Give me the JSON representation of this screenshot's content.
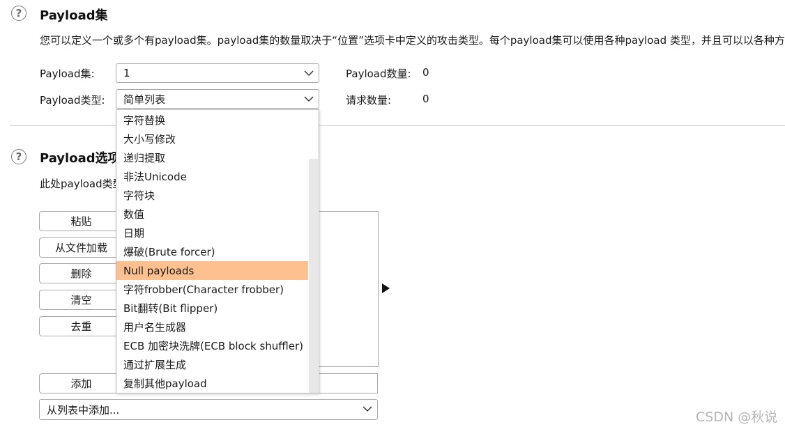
{
  "payload_sets_section": {
    "help_icon": "?",
    "title": "Payload集",
    "description": "您可以定义一个或多个有payload集。payload集的数量取决于“位置”选项卡中定义的攻击类型。每个payload集可以使用各种payload 类型，并且可以以各种方式",
    "payload_set_label": "Payload集:",
    "payload_set_value": "1",
    "payload_count_label": "Payload数量:",
    "payload_count_value": "0",
    "payload_type_label": "Payload类型:",
    "payload_type_value": "简单列表",
    "request_count_label": "请求数量:",
    "request_count_value": "0"
  },
  "payload_options_section": {
    "help_icon": "?",
    "title": "Payload选项",
    "description": "此处payload类型",
    "buttons": {
      "paste": "粘贴",
      "load_from_file": "从文件加载",
      "delete": "删除",
      "clear": "清空",
      "dedupe": "去重",
      "add": "添加"
    },
    "add_from_list": "从列表中添加..."
  },
  "payload_type_dropdown": {
    "items": [
      "字符替换",
      "大小写修改",
      "递归提取",
      "非法Unicode",
      "字符块",
      "数值",
      "日期",
      "爆破(Brute forcer)",
      "Null payloads",
      "字符frobber(Character frobber)",
      "Bit翻转(Bit flipper)",
      "用户名生成器",
      "ECB 加密块洗牌(ECB block shuffler)",
      "通过扩展生成",
      "复制其他payload"
    ],
    "highlighted": "Null payloads",
    "highlight_color": "#ffc08f"
  },
  "watermark": "CSDN @秋说"
}
